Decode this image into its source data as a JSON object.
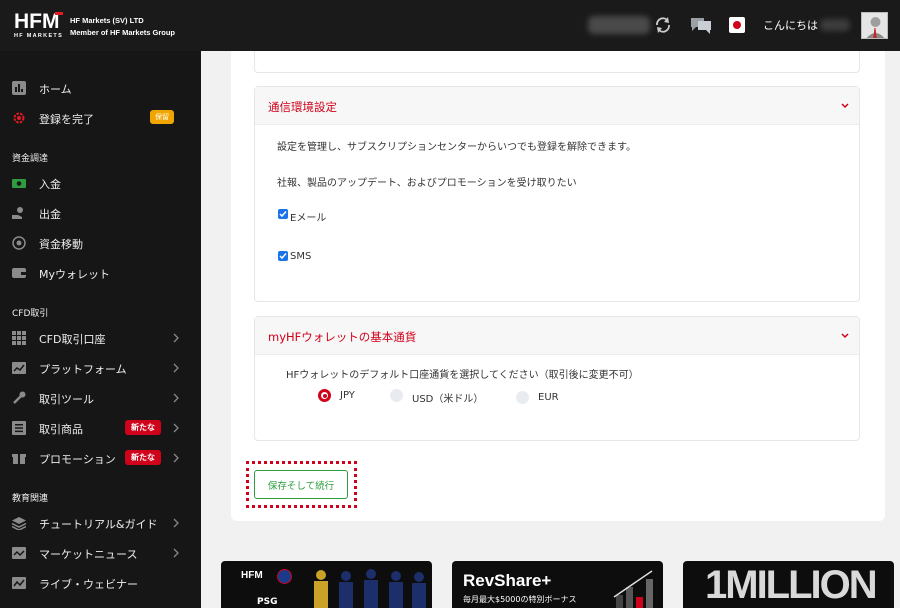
{
  "header": {
    "logo_mark": "HFM",
    "logo_sub": "HF MARKETS",
    "company_line1": "HF Markets (SV) LTD",
    "company_line2": "Member of HF Markets Group",
    "greeting": "こんにちは"
  },
  "sidebar": {
    "home": "ホーム",
    "complete_registration": "登録を完了",
    "pending_badge": "保留",
    "section_funding": "資金調達",
    "deposit": "入金",
    "withdrawal": "出金",
    "transfer": "資金移動",
    "my_wallet": "Myウォレット",
    "section_cfd": "CFD取引",
    "cfd_account": "CFD取引口座",
    "platform": "プラットフォーム",
    "trading_tools": "取引ツール",
    "products": "取引商品",
    "products_badge": "新たな",
    "promotions": "プロモーション",
    "promotions_badge": "新たな",
    "section_education": "教育関連",
    "tutorials": "チュートリアル&ガイド",
    "market_news": "マーケットニュース",
    "webinar": "ライブ・ウェビナー"
  },
  "comms_panel": {
    "title": "通信環境設定",
    "desc": "設定を管理し、サブスクリプションセンターからいつでも登録を解除できます。",
    "question": "社報、製品のアップデート、およびプロモーションを受け取りたい",
    "email_label": "Eメール",
    "email_checked": true,
    "sms_label": "SMS",
    "sms_checked": true
  },
  "wallet_panel": {
    "title": "myHFウォレットの基本通貨",
    "desc": "HFウォレットのデフォルト口座通貨を選択してください（取引後に変更不可）",
    "options": [
      "JPY",
      "USD（米ドル）",
      "EUR"
    ],
    "selected": "JPY"
  },
  "actions": {
    "save_continue": "保存そして続行"
  },
  "banners": {
    "b1_brand": "HFM",
    "b1_text": "PSG",
    "b2_title": "RevShare+",
    "b2_sub": "毎月最大$5000の特別ボーナス",
    "b3_text": "1MILLION"
  },
  "colors": {
    "accent_red": "#d0021b",
    "save_green": "#2e9c3f",
    "sidebar_bg": "#161616",
    "badge_orange": "#f0a500",
    "checkbox_blue": "#1a73e8"
  }
}
